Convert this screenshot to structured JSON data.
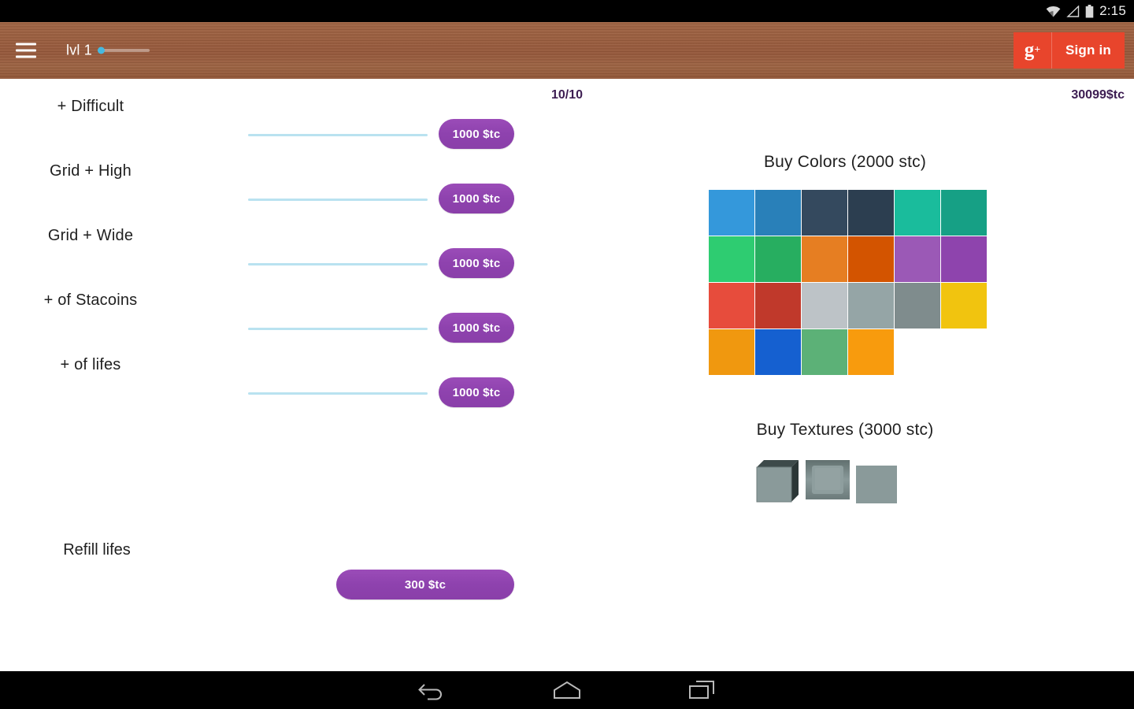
{
  "status_bar": {
    "clock": "2:15",
    "icons": [
      "wifi-icon",
      "signal-icon",
      "battery-icon"
    ]
  },
  "app_bar": {
    "menu_icon": "hamburger-menu-icon",
    "level_label": "lvl 1",
    "level_progress_percent": 4,
    "sign_in": {
      "icon_letter": "g",
      "icon_plus": "+",
      "label": "Sign in",
      "background": "#e8452c"
    },
    "background_color": "#9b5f40"
  },
  "header_stats": {
    "lives": "10/10",
    "coins": "30099$tc",
    "color": "#3d1d52"
  },
  "upgrades": {
    "items": [
      {
        "label": "+ Difficult",
        "price": "1000 $tc"
      },
      {
        "label": "Grid + High",
        "price": "1000 $tc"
      },
      {
        "label": "Grid + Wide",
        "price": "1000 $tc"
      },
      {
        "label": "+ of Stacoins",
        "price": "1000 $tc"
      },
      {
        "label": "+ of lifes",
        "price": "1000 $tc"
      }
    ],
    "refill": {
      "label": "Refill lifes",
      "price": "300 $tc"
    },
    "button_color": "#8e42ae",
    "track_color": "#b9e2f0"
  },
  "shop": {
    "colors_title": "Buy Colors (2000 stc)",
    "textures_title": "Buy Textures (3000 stc)",
    "color_swatches": [
      "#3498db",
      "#2980b9",
      "#34495e",
      "#2c3e50",
      "#1abc9c",
      "#16a085",
      "#2ecc71",
      "#27ae60",
      "#e67e22",
      "#d35400",
      "#9b59b6",
      "#8e44ad",
      "#e74c3c",
      "#c0392b",
      "#bdc3c7",
      "#95a5a6",
      "#7f8c8d",
      "#f1c40f",
      "#f0980f",
      "#1560d0",
      "#5cb177",
      "#f89b0d"
    ],
    "textures": [
      "cube-3d-texture",
      "beveled-texture",
      "flat-texture"
    ],
    "texture_base_color": "#8a9a9a"
  },
  "nav_bar": {
    "buttons": [
      "back-icon",
      "home-icon",
      "recent-apps-icon"
    ]
  }
}
